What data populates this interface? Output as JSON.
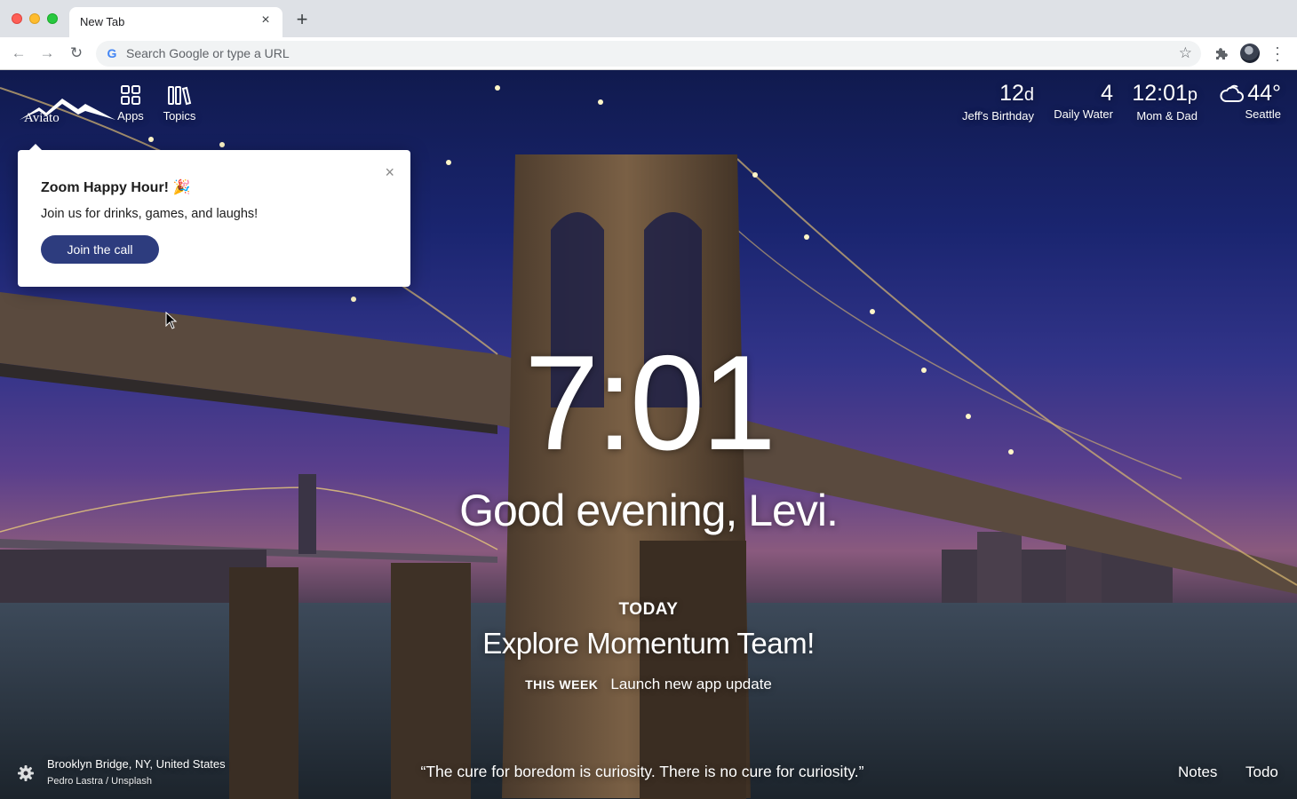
{
  "browser": {
    "tab_title": "New Tab",
    "tab_close": "×",
    "new_tab": "+",
    "address_placeholder": "Search Google or type a URL",
    "google_letter": "G"
  },
  "nav": {
    "logo_text": "Aviato",
    "apps_label": "Apps",
    "topics_label": "Topics"
  },
  "metrics": [
    {
      "value": "12",
      "unit": "d",
      "label": "Jeff's Birthday"
    },
    {
      "value": "4",
      "unit": "",
      "label": "Daily Water"
    },
    {
      "value": "12:01",
      "unit": "p",
      "label": "Mom & Dad"
    },
    {
      "value": "44°",
      "unit": "",
      "label": "Seattle",
      "icon": "cloud-icon"
    }
  ],
  "popup": {
    "title": "Zoom Happy Hour! 🎉",
    "body": "Join us for drinks, games, and laughs!",
    "button": "Join the call",
    "close": "×"
  },
  "clock": "7:01",
  "greeting": "Good evening, Levi.",
  "focus": {
    "label": "TODAY",
    "text": "Explore Momentum Team!",
    "week_label": "THIS WEEK",
    "week_text": "Launch new app update"
  },
  "footer": {
    "location": "Brooklyn Bridge, NY, United States",
    "credit": "Pedro Lastra / Unsplash",
    "quote": "“The cure for boredom is curiosity. There is no cure for curiosity.”",
    "notes": "Notes",
    "todo": "Todo"
  },
  "colors": {
    "button": "#2d3c7e",
    "sky_top": "#101a4e",
    "sky_horizon": "#8a5a7e"
  }
}
